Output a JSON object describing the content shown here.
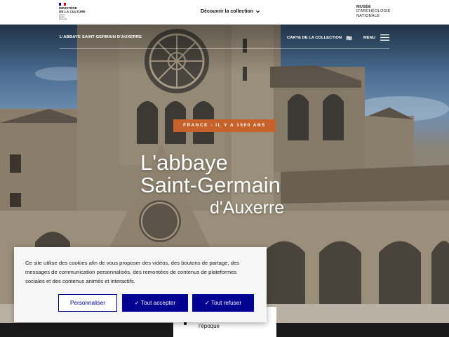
{
  "header": {
    "ministry_logo": {
      "lines": "MINISTÈRE\nDE LA CULTURE",
      "motto": "Liberté\nÉgalité\nFraternité",
      "flag_colors": [
        "#000091",
        "#ffffff",
        "#e1000f"
      ]
    },
    "discover_label": "Découvrir la collection",
    "discover_icon": "chevron-down-icon",
    "museum_logo": {
      "line1": "MUSÉE",
      "line2": "D'ARCHÉOLOGIE",
      "line3": "NATIONALE"
    }
  },
  "subnav": {
    "site_name": "L'ABBAYE SAINT-GERMAIN D'AUXERRE",
    "map_link_label": "CARTE DE LA COLLECTION",
    "map_icon": "map-icon",
    "menu_label": "MENU",
    "menu_icon": "hamburger-icon"
  },
  "hero": {
    "badge": "FRANCE - IL Y A 1500 ANS",
    "title_line1": "L'abbaye",
    "title_line2": "Saint-Germain",
    "title_line3": "d'Auxerre"
  },
  "bottom_card": {
    "caption": "l'époque"
  },
  "cookie_banner": {
    "message": "Ce site utilise des cookies afin de vous proposer des vidéos, des boutons de partage, des messages de communication personnalisés, des remontées de contenus de plateformes sociales et des contenus animés et interactifs.",
    "personalize_label": "Personnaliser",
    "accept_label": "✓ Tout accepter",
    "refuse_label": "✓ Tout refuser"
  },
  "colors": {
    "accent_blue": "#000091",
    "badge_orange": "#c7632a"
  }
}
